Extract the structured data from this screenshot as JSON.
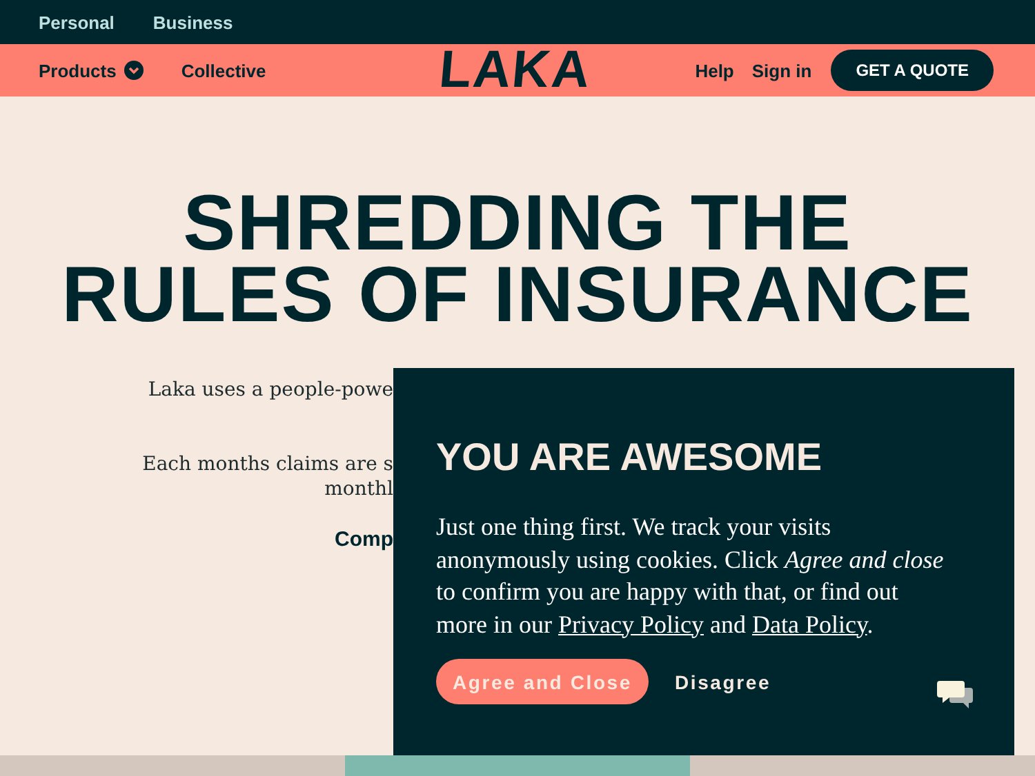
{
  "top_bar": {
    "links": [
      {
        "label": "Personal"
      },
      {
        "label": "Business"
      }
    ]
  },
  "nav": {
    "left": [
      {
        "label": "Products",
        "kind": "dropdown"
      },
      {
        "label": "Collective",
        "kind": "link"
      }
    ],
    "logo": "LAKA",
    "right": [
      {
        "label": "Help",
        "kind": "link"
      },
      {
        "label": "Sign in",
        "kind": "link"
      },
      {
        "label": "GET A QUOTE",
        "kind": "button"
      }
    ]
  },
  "hero": {
    "headline": [
      "SHREDDING THE",
      "RULES OF INSURANCE"
    ],
    "lines": [
      {
        "text": "Laka uses a people-powe",
        "kind": "text"
      },
      {
        "text": "Each months claims are s",
        "kind": "text"
      },
      {
        "text": "monthl",
        "kind": "text"
      },
      {
        "text": "Comp",
        "kind": "strong"
      }
    ]
  },
  "cookie_dialog": {
    "title": "YOU ARE AWESOME",
    "body": [
      {
        "text": "Just one thing first. We track your visits anonymously using cookies. Click ",
        "kind": "text"
      },
      {
        "text": "Agree and close",
        "kind": "italic"
      },
      {
        "text": " to confirm you are happy with that, or find out more in our ",
        "kind": "text"
      },
      {
        "text": "Privacy Policy",
        "kind": "link"
      },
      {
        "text": " and ",
        "kind": "text"
      },
      {
        "text": "Data Policy",
        "kind": "link"
      },
      {
        "text": ".",
        "kind": "text"
      }
    ],
    "buttons": [
      {
        "label": "Agree and Close",
        "kind": "primary"
      },
      {
        "label": "Disagree",
        "kind": "plain"
      }
    ]
  }
}
